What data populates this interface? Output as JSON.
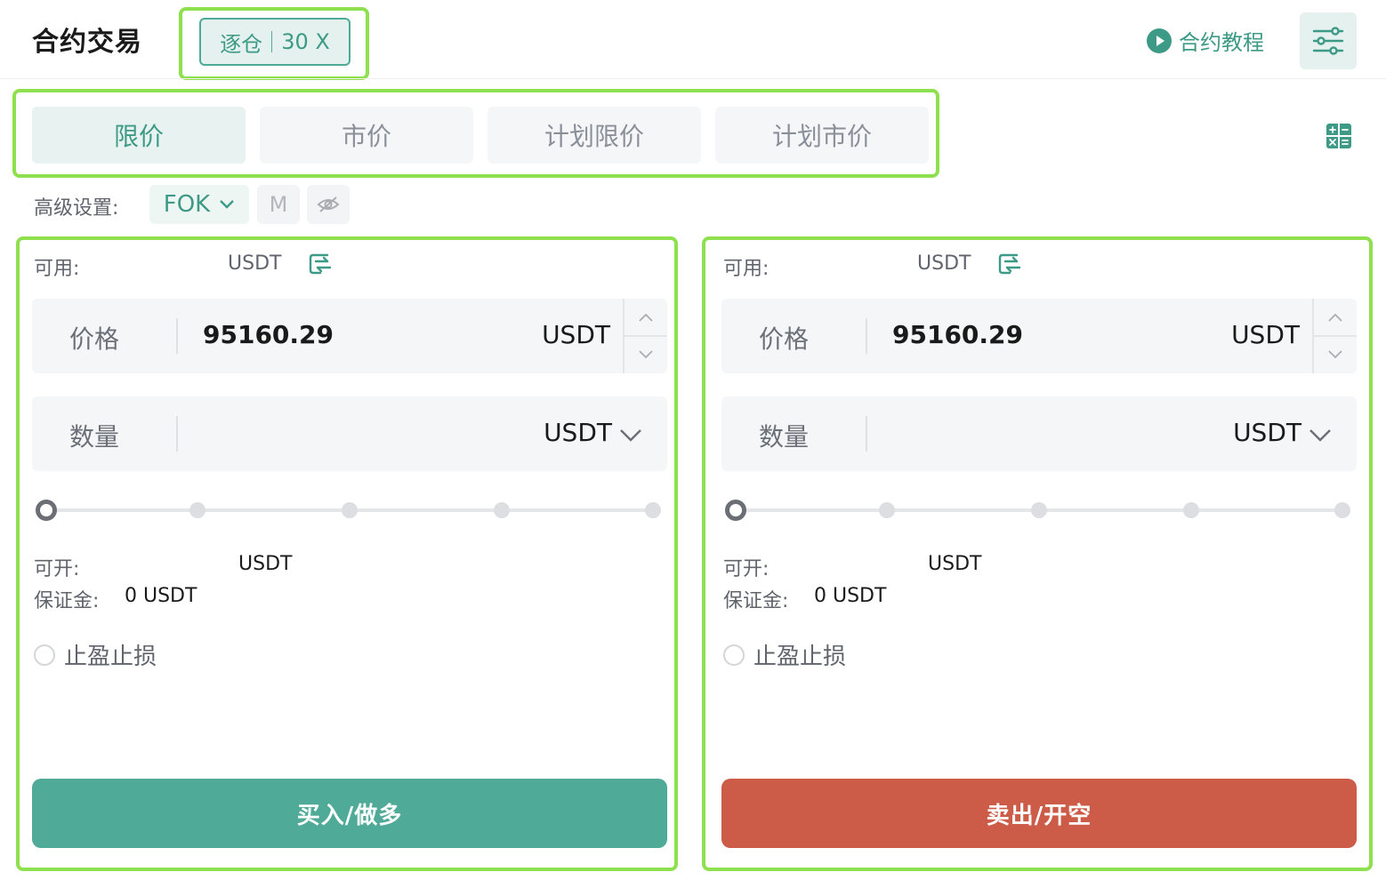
{
  "header": {
    "title": "合约交易",
    "margin_mode": "逐仓",
    "leverage": "30 X",
    "tutorial_label": "合约教程",
    "tutorial_icon": "play-icon",
    "settings_icon": "sliders-icon"
  },
  "tabs": [
    {
      "label": "限价",
      "active": true
    },
    {
      "label": "市价",
      "active": false
    },
    {
      "label": "计划限价",
      "active": false
    },
    {
      "label": "计划市价",
      "active": false
    }
  ],
  "advanced": {
    "label": "高级设置:",
    "order_type": "FOK",
    "m_button": "M",
    "hidden_icon": "eye-off-icon"
  },
  "buy_panel": {
    "available_label": "可用:",
    "available_unit": "USDT",
    "price_label": "价格",
    "price_value": "95160.29",
    "price_unit": "USDT",
    "qty_label": "数量",
    "qty_unit": "USDT",
    "slider_percent": 0,
    "openable_label": "可开:",
    "openable_unit": "USDT",
    "margin_label": "保证金:",
    "margin_value": "0 USDT",
    "tp_sl_label": "止盈止损",
    "action_label": "买入/做多"
  },
  "sell_panel": {
    "available_label": "可用:",
    "available_unit": "USDT",
    "price_label": "价格",
    "price_value": "95160.29",
    "price_unit": "USDT",
    "qty_label": "数量",
    "qty_unit": "USDT",
    "slider_percent": 0,
    "openable_label": "可开:",
    "openable_unit": "USDT",
    "margin_label": "保证金:",
    "margin_value": "0 USDT",
    "tp_sl_label": "止盈止损",
    "action_label": "卖出/开空"
  },
  "colors": {
    "accent": "#3d9a86",
    "buy": "#4faa97",
    "sell": "#cc5c48",
    "highlight": "#8ee04f"
  }
}
